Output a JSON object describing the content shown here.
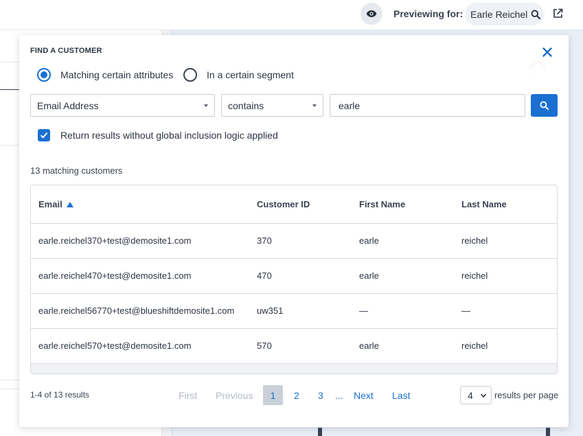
{
  "header": {
    "previewing_label": "Previewing for:",
    "preview_name": "Earle Reichel"
  },
  "find_customer": {
    "title": "FIND A CUSTOMER",
    "radio_options": [
      {
        "label": "Matching certain attributes",
        "selected": true
      },
      {
        "label": "In a certain segment",
        "selected": false
      }
    ],
    "attribute_select": "Email Address",
    "operator_select": "contains",
    "search_value": "earle",
    "checkbox": {
      "label": "Return results without global inclusion logic applied",
      "checked": true
    },
    "match_count": "13 matching customers"
  },
  "table": {
    "columns": [
      "Email",
      "Customer ID",
      "First Name",
      "Last Name"
    ],
    "sort_column": "Email",
    "sort_direction": "ascending",
    "rows": [
      [
        "earle.reichel370+test@demosite1.com",
        "370",
        "earle",
        "reichel"
      ],
      [
        "earle.reichel470+test@demosite1.com",
        "470",
        "earle",
        "reichel"
      ],
      [
        "earle.reichel56770+test@blueshiftdemosite1.com",
        "uw351",
        "—",
        "—"
      ],
      [
        "earle.reichel570+test@demosite1.com",
        "570",
        "earle",
        "reichel"
      ]
    ]
  },
  "pagination": {
    "summary": "1-4 of 13 results",
    "first": "First",
    "previous": "Previous",
    "pages": [
      "1",
      "2",
      "3"
    ],
    "current_page": "1",
    "ellipsis": "...",
    "next": "Next",
    "last": "Last",
    "per_page_value": "4",
    "per_page_label": "results per page"
  },
  "colors": {
    "accent": "#1a6fd1",
    "text": "#2b3340",
    "border": "#d6dae0"
  },
  "icons": {
    "eye": "eye-icon",
    "search": "search-icon",
    "external": "external-link-icon",
    "close": "close-icon",
    "check": "checkmark-icon",
    "sort": "sort-ascending-icon"
  }
}
